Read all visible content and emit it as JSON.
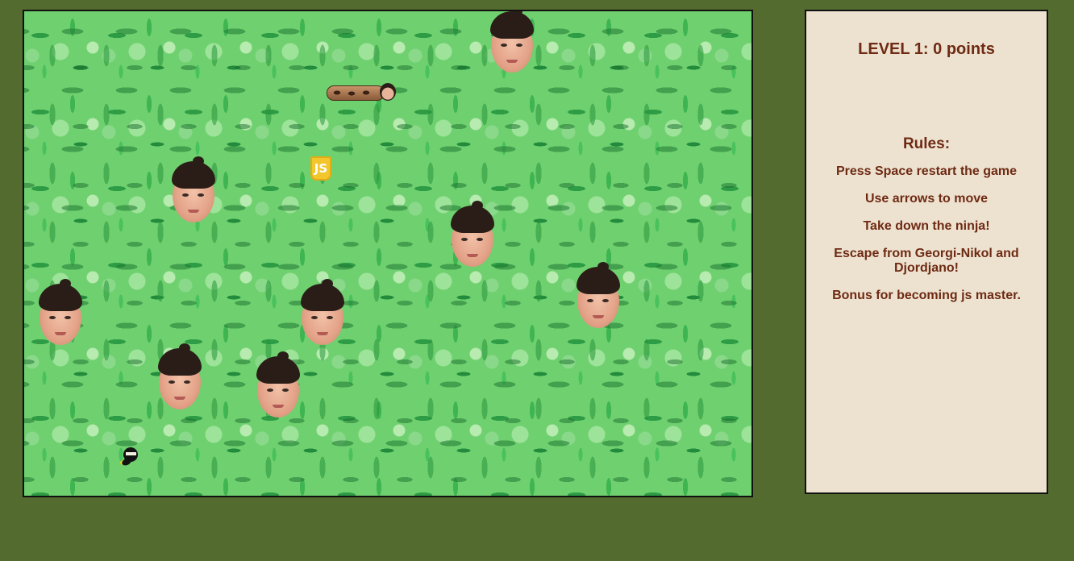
{
  "game": {
    "status": "LEVEL 1: 0 points",
    "rules_title": "Rules:",
    "rules": [
      "Press Space restart the game",
      "Use arrows to move",
      "Take down the ninja!",
      "Escape from Georgi-Nikol and Djordjano!",
      "Bonus for becoming js master."
    ],
    "sprites": {
      "player": "snake with face head",
      "enemies": "floating face heads",
      "target": "ninja",
      "bonus": "js badge"
    },
    "bonus_label": "JS"
  },
  "colors": {
    "page_background": "#536b2f",
    "panel_background": "#ede2d0",
    "panel_text": "#6e2a13",
    "board_leaves": "#6fd06f",
    "js_badge": "#f2c62c"
  }
}
